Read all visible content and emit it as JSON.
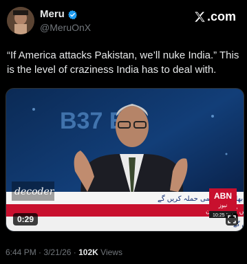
{
  "author": {
    "display_name": "Meru",
    "handle": "@MeruOnX",
    "verified": true
  },
  "brand": {
    "label": ".com"
  },
  "tweet": {
    "text": "“If America attacks Pakistan, we’ll nuke India.” This is the level of craziness India has to deal with."
  },
  "video": {
    "duration": "0:29",
    "background_text": "B37  E2",
    "show_name": "decoder",
    "channel_logo": "ABN",
    "channel_logo_sub": "نیوز",
    "clock": "10:25 PM",
    "headline_text": "یکھ نہ ہو اتو بھارت پر ایٹمی حملہ کریں گے",
    "ticker_main": "اعلیٰ افسران عمید کے روز یوٹیلیٹی کی بہتر فراہمی کو یقینی بنانیں گے : ترجمان",
    "ticker_secondary": "مری : جاوید عبید قائم مقامیس شام 7:45 پر ہوگی صبح مریں گے"
  },
  "meta": {
    "time": "6:44 PM",
    "separator": "·",
    "date": "3/21/26",
    "views_count": "102K",
    "views_label": "Views"
  },
  "colors": {
    "background": "#000000",
    "text_primary": "#e7e9ea",
    "text_secondary": "#71767b",
    "verified": "#1d9bf0",
    "ticker_red": "#c8102e"
  }
}
